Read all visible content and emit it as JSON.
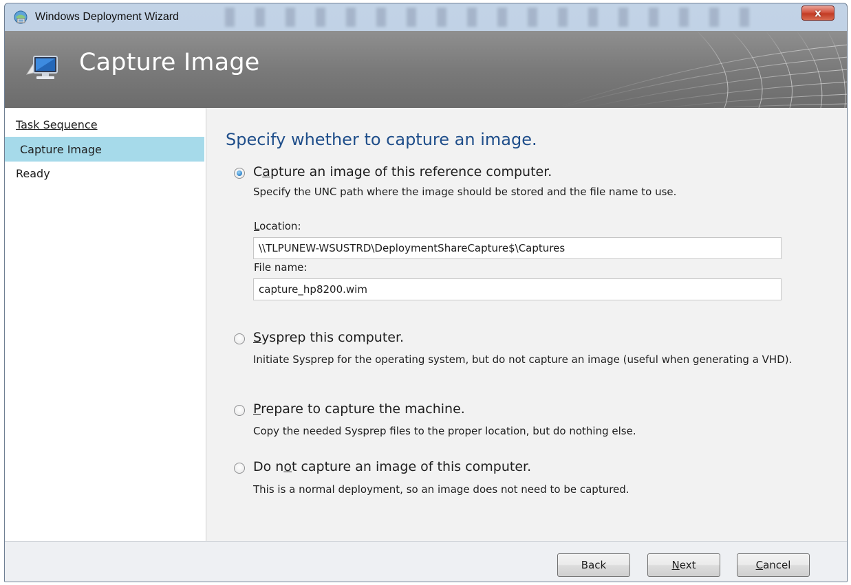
{
  "window": {
    "title": "Windows Deployment Wizard",
    "close_glyph": "x",
    "icons": {
      "app": "deployment-wizard-icon",
      "close": "close-icon"
    }
  },
  "banner": {
    "title": "Capture Image",
    "icon": "computer-capture-icon"
  },
  "nav": {
    "items": [
      {
        "label": "Task Sequence",
        "state": "link"
      },
      {
        "label": "Capture Image",
        "state": "selected"
      },
      {
        "label": "Ready",
        "state": "normal"
      }
    ]
  },
  "content": {
    "heading": "Specify whether to capture an image.",
    "options": [
      {
        "label_pre": "C",
        "label_access": "a",
        "label_post": "pture an image of this reference computer.",
        "description": "Specify the UNC path where the image should be stored and the file name to use.",
        "checked": true
      },
      {
        "label_pre": "",
        "label_access": "S",
        "label_post": "ysprep this computer.",
        "description": "Initiate Sysprep for the operating system, but do not capture an image (useful when generating a VHD).",
        "checked": false
      },
      {
        "label_pre": "",
        "label_access": "P",
        "label_post": "repare to capture the machine.",
        "description": "Copy the needed Sysprep files to the proper location, but do nothing else.",
        "checked": false
      },
      {
        "label_pre": "Do n",
        "label_access": "o",
        "label_post": "t capture an image of this computer.",
        "description": "This is a normal deployment, so an image does not need to be captured.",
        "checked": false
      }
    ],
    "location": {
      "label_access": "L",
      "label_post": "ocation:",
      "value": "\\\\TLPUNEW-WSUSTRD\\DeploymentShareCapture$\\Captures"
    },
    "filename": {
      "label": "File name:",
      "value": "capture_hp8200.wim"
    }
  },
  "footer": {
    "back_label": "Back",
    "next_access": "N",
    "next_post": "ext",
    "cancel_access": "C",
    "cancel_post": "ancel"
  },
  "colors": {
    "heading": "#1f4e8a",
    "nav_selected": "#a6daea",
    "banner": "#7a7a7a",
    "close_button": "#c23b24",
    "content_bg": "#f2f2f2"
  }
}
